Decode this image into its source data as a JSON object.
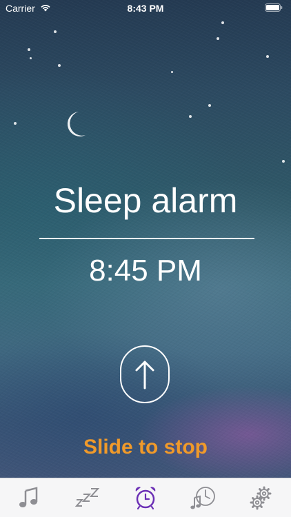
{
  "status_bar": {
    "carrier": "Carrier",
    "time": "8:43 PM",
    "icons": [
      "wifi-icon",
      "battery-icon"
    ]
  },
  "alarm": {
    "title": "Sleep alarm",
    "time": "8:45 PM",
    "slide_label": "Slide to stop",
    "handle_icon": "arrow-up-icon"
  },
  "tab_bar": {
    "tabs": [
      {
        "icon": "music-note-icon",
        "selected": false
      },
      {
        "icon": "zzz-icon",
        "selected": false
      },
      {
        "icon": "alarm-clock-icon",
        "selected": true
      },
      {
        "icon": "clock-music-icon",
        "selected": false
      },
      {
        "icon": "gears-icon",
        "selected": false
      }
    ]
  },
  "colors": {
    "accent_orange": "#f09a2a",
    "selected_tab": "#6b2fb5",
    "unselected_tab": "#8e8e93",
    "text": "#ffffff"
  }
}
